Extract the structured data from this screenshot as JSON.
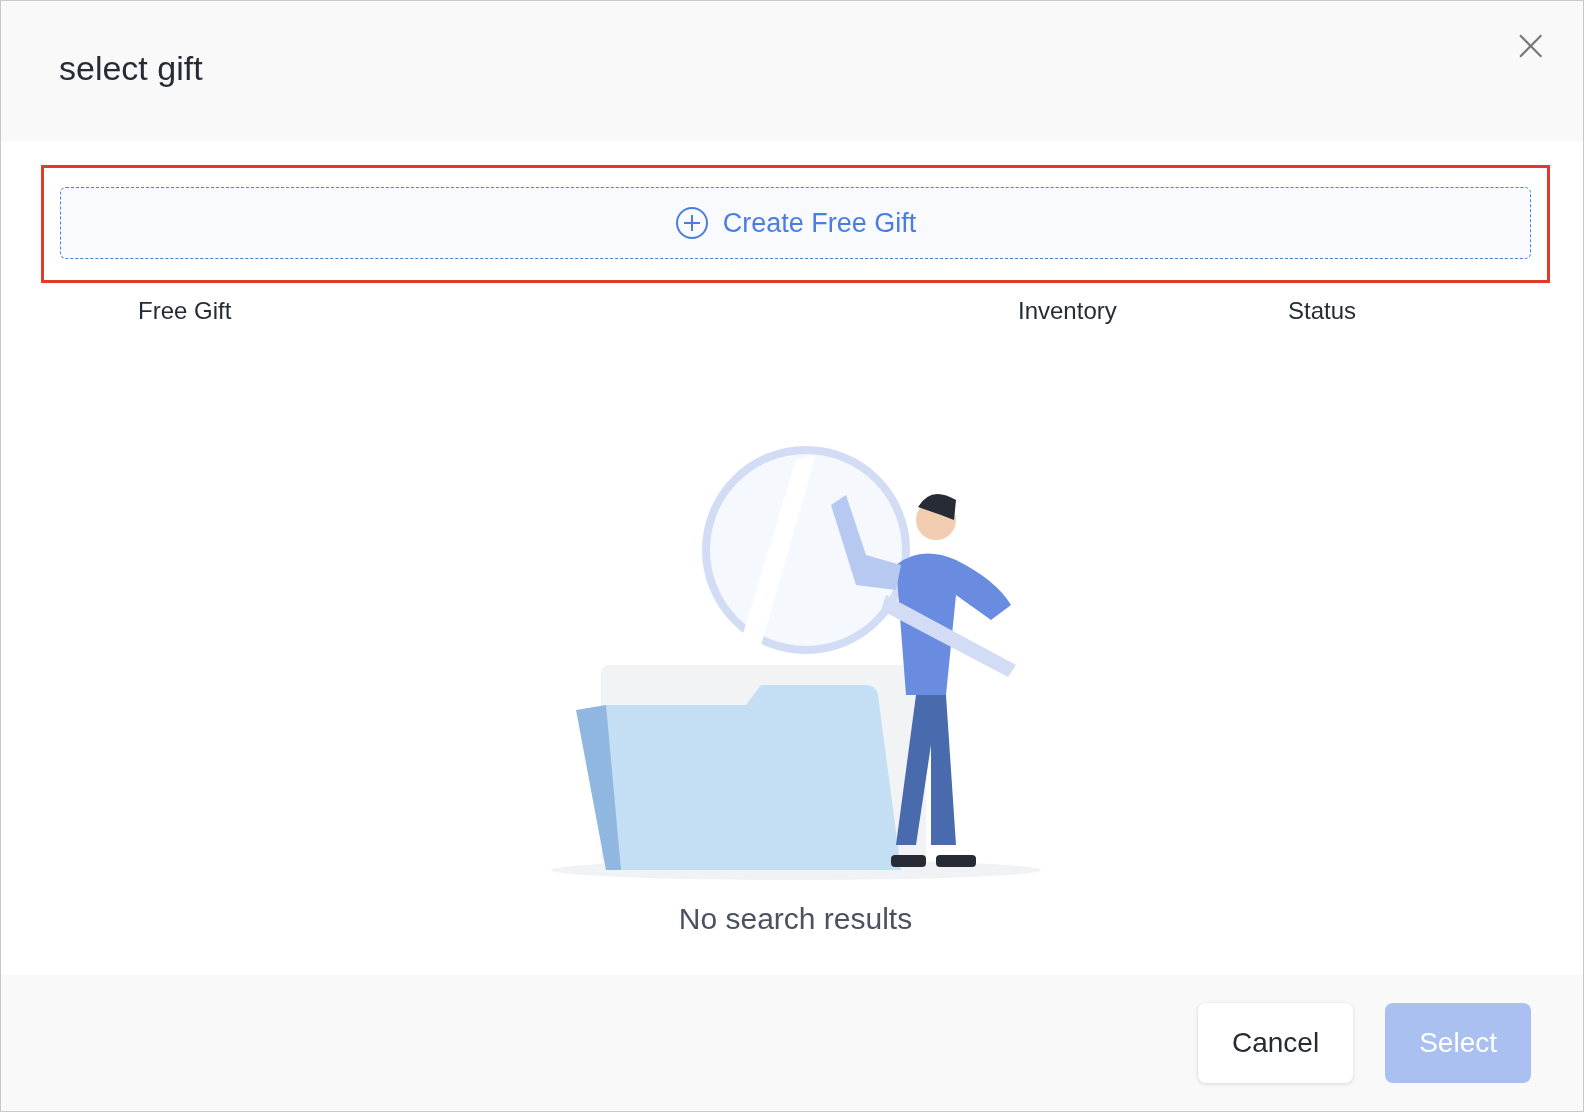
{
  "dialog": {
    "title": "select gift",
    "close_label": "×"
  },
  "create_button": {
    "label": "Create Free Gift"
  },
  "table": {
    "columns": [
      "Free Gift",
      "Inventory",
      "Status"
    ]
  },
  "empty_state": {
    "message": "No search results"
  },
  "buttons": [
    {
      "label": "Cancel",
      "kind": "secondary",
      "disabled": false
    },
    {
      "label": "Select",
      "kind": "primary",
      "disabled": true
    }
  ]
}
